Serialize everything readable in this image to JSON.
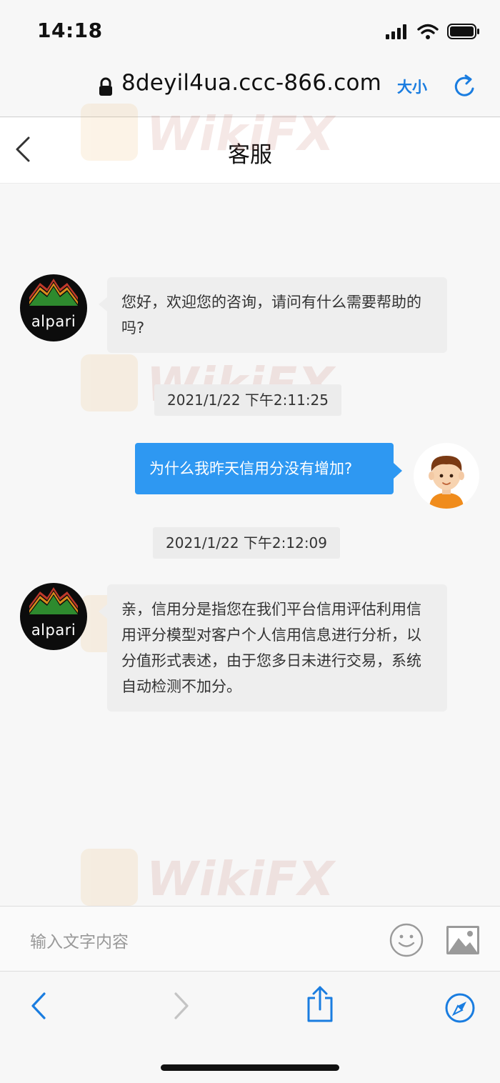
{
  "status_bar": {
    "time": "14:18"
  },
  "browser": {
    "url": "8deyil4ua.ccc-866.com",
    "text_size_label": "大小"
  },
  "nav": {
    "title": "客服"
  },
  "messages": [
    {
      "from": "agent",
      "text": "您好，欢迎您的咨询，请问有什么需要帮助的吗?"
    },
    {
      "type": "timestamp",
      "text": "2021/1/22 下午2:11:25"
    },
    {
      "from": "user",
      "text": "为什么我昨天信用分没有增加?"
    },
    {
      "type": "timestamp",
      "text": "2021/1/22 下午2:12:09"
    },
    {
      "from": "agent",
      "text": "亲，信用分是指您在我们平台信用评估利用信用评分模型对客户个人信用信息进行分析，以分值形式表述，由于您多日未进行交易，系统自动检测不加分。"
    }
  ],
  "agent_logo_text": "alpari",
  "watermark": "WikiFX",
  "input": {
    "placeholder": "输入文字内容"
  },
  "colors": {
    "accent": "#1a7de0",
    "user_bubble": "#2e98f2",
    "agent_bubble": "#eeeeee"
  },
  "icons": [
    "lock-icon",
    "reload-icon",
    "back-icon",
    "emoji-icon",
    "image-icon",
    "forward-icon",
    "share-icon",
    "compass-icon"
  ]
}
